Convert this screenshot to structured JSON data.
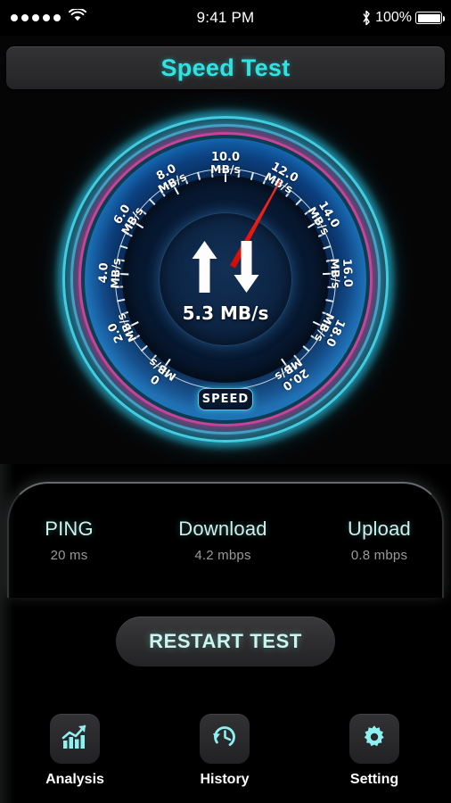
{
  "statusbar": {
    "signal_dots": 5,
    "wifi_icon": "wifi-icon",
    "time": "9:41 PM",
    "bluetooth_icon": "bluetooth-icon",
    "battery_percent": "100%",
    "battery_icon": "battery-full-icon"
  },
  "header": {
    "title": "Speed Test"
  },
  "gauge": {
    "unit": "MB/s",
    "badge_label": "SPEED",
    "center_value": "5.3 MB/s",
    "needle_value": 12.0,
    "min": 0,
    "max": 20,
    "up_arrow_icon": "upload-arrow-icon",
    "down_arrow_icon": "download-arrow-icon",
    "ticks": [
      {
        "value": "0",
        "unit": "MB/s"
      },
      {
        "value": "2.0",
        "unit": "MB/s"
      },
      {
        "value": "4.0",
        "unit": "MB/s"
      },
      {
        "value": "6.0",
        "unit": "MB/s"
      },
      {
        "value": "8.0",
        "unit": "MB/s"
      },
      {
        "value": "10.0",
        "unit": "MB/s"
      },
      {
        "value": "12.0",
        "unit": "MB/s"
      },
      {
        "value": "14.0",
        "unit": "MB/s"
      },
      {
        "value": "16.0",
        "unit": "MB/s"
      },
      {
        "value": "18.0",
        "unit": "MB/s"
      },
      {
        "value": "20.0",
        "unit": "MB/s"
      }
    ],
    "colors": {
      "ring_cyan": "#49dff2",
      "ring_magenta": "#e8348f",
      "dial_blue": "#1678c8",
      "needle_red": "#ff2b1e"
    }
  },
  "stats": [
    {
      "label": "PING",
      "value": "20 ms"
    },
    {
      "label": "Download",
      "value": "4.2 mbps"
    },
    {
      "label": "Upload",
      "value": "0.8 mbps"
    }
  ],
  "restart_button": {
    "label": "RESTART TEST"
  },
  "nav": {
    "items": [
      {
        "label": "Analysis",
        "icon": "chart-trend-icon"
      },
      {
        "label": "History",
        "icon": "clock-rewind-icon"
      },
      {
        "label": "Setting",
        "icon": "gear-icon"
      }
    ],
    "accent": "#8ef0f0"
  }
}
